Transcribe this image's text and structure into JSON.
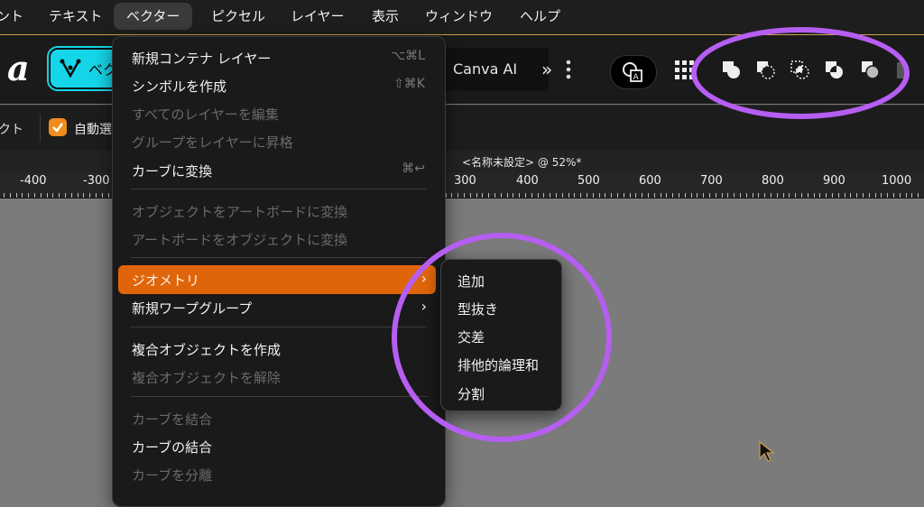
{
  "menubar": {
    "items": [
      "ント",
      "テキスト",
      "ベクター",
      "ピクセル",
      "レイヤー",
      "表示",
      "ウィンドウ",
      "ヘルプ"
    ]
  },
  "toolbar": {
    "vector_label": "ベク",
    "canva_ai_label": "Canva AI",
    "more_label": "»",
    "icons": [
      "studio-link-icon",
      "grid-icon",
      "boolean-add-icon",
      "boolean-subtract-icon",
      "boolean-intersect-icon",
      "boolean-xor-icon",
      "boolean-divide-icon"
    ]
  },
  "subtoolbar": {
    "prev_label": "クト",
    "auto_select_label": "自動選"
  },
  "document": {
    "title": "<名称未設定> @ 52%*"
  },
  "ruler": {
    "labels": [
      "-400",
      "-300",
      "300",
      "400",
      "500",
      "600",
      "700",
      "800",
      "900",
      "1000"
    ]
  },
  "vector_menu": {
    "items": [
      {
        "label": "新規コンテナ レイヤー",
        "shortcut": "⌥⌘L",
        "disabled": false
      },
      {
        "label": "シンボルを作成",
        "shortcut": "⇧⌘K",
        "disabled": false
      },
      {
        "label": "すべてのレイヤーを編集",
        "shortcut": "",
        "disabled": true
      },
      {
        "label": "グループをレイヤーに昇格",
        "shortcut": "",
        "disabled": true
      },
      {
        "label": "カーブに変換",
        "shortcut": "⌘↩",
        "disabled": false
      },
      {
        "label": "オブジェクトをアートボードに変換",
        "shortcut": "",
        "disabled": true
      },
      {
        "label": "アートボードをオブジェクトに変換",
        "shortcut": "",
        "disabled": true
      },
      {
        "label": "ジオメトリ",
        "shortcut": "",
        "disabled": false
      },
      {
        "label": "新規ワープグループ",
        "shortcut": "",
        "disabled": false
      },
      {
        "label": "複合オブジェクトを作成",
        "shortcut": "",
        "disabled": false
      },
      {
        "label": "複合オブジェクトを解除",
        "shortcut": "",
        "disabled": true
      },
      {
        "label": "カーブを結合",
        "shortcut": "",
        "disabled": true
      },
      {
        "label": "カーブの結合",
        "shortcut": "",
        "disabled": false
      },
      {
        "label": "カーブを分離",
        "shortcut": "",
        "disabled": true
      }
    ],
    "chevron": "›"
  },
  "geometry_submenu": {
    "items": [
      "追加",
      "型抜き",
      "交差",
      "排他的論理和",
      "分割"
    ]
  },
  "colors": {
    "accent_orange": "#e0650a",
    "annotation_purple": "#b65ef2",
    "vector_cyan": "#15d6e8"
  }
}
